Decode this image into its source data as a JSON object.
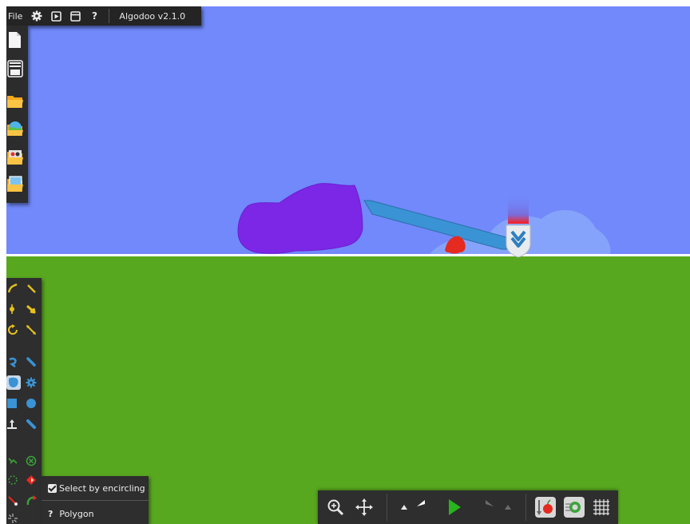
{
  "app": {
    "title": "Algodoo v2.1.0"
  },
  "menubar": {
    "file_label": "File",
    "icons": [
      "gear-icon",
      "play-square-icon",
      "window-icon",
      "help-icon"
    ],
    "help_label": "?"
  },
  "sidebar": {
    "items": [
      "new-scene-icon",
      "toolbar-toggle-icon",
      "open-folder-icon",
      "planet-folder-icon",
      "cinema-folder-icon",
      "picture-folder-icon"
    ]
  },
  "tools": {
    "items": [
      "sketch-tool-icon",
      "knife-tool-icon",
      "drag-tool-icon",
      "move-tool-icon",
      "rotate-tool-icon",
      "scale-tool-icon",
      "rope-tool-icon",
      "brush-tool-icon",
      "polygon-tool-icon",
      "gear-tool-icon",
      "box-tool-icon",
      "circle-tool-icon",
      "plane-tool-icon",
      "pen-tool-icon",
      "fixate-tool-icon",
      "axle-tool-icon",
      "spring-tool-icon",
      "thruster-tool-icon",
      "chain-tool-icon",
      "laser-tool-icon",
      "tracer-tool-icon"
    ]
  },
  "options": {
    "select_by_encircling_label": "Select by encircling",
    "select_by_encircling_checked": true,
    "help_label": "?",
    "tool_label": "Polygon"
  },
  "simulation": {
    "zoom_icon": "zoom-icon",
    "pan_icon": "pan-icon",
    "undo_dropdown_icon": "up-arrow-icon",
    "undo_icon": "undo-icon",
    "play_icon": "play-icon",
    "redo_icon": "redo-icon",
    "redo_dropdown_icon": "up-arrow-icon",
    "gravity_icon": "gravity-icon",
    "air_icon": "air-friction-icon",
    "grid_icon": "grid-icon"
  },
  "colors": {
    "sky": "#7189fb",
    "ground": "#58a81f",
    "blob": "#7c27e6",
    "plank": "#3a93d4",
    "red_shape": "#e52a1f",
    "panel": "#2e2e2e",
    "play": "#27b41c"
  }
}
